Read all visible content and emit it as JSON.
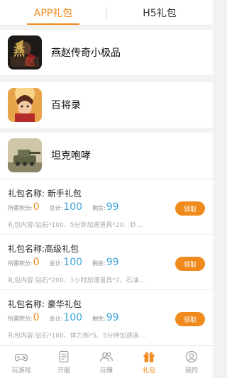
{
  "tabs": [
    {
      "label": "APP礼包",
      "active": true
    },
    {
      "label": "H5礼包",
      "active": false
    }
  ],
  "games": [
    {
      "name": "燕赵传奇小极品",
      "icon": "yanzhao-game-icon"
    },
    {
      "name": "百将录",
      "icon": "baijianglu-game-icon"
    },
    {
      "name": "坦克咆哮",
      "icon": "tank-game-icon"
    }
  ],
  "gifts": [
    {
      "title": "礼包名称: 新手礼包",
      "points_label": "所需积分:",
      "points": "0",
      "total_label": "总计:",
      "total": "100",
      "remain_label": "剩余:",
      "remain": "99",
      "content": "礼包内容:钻石*100、5分钟加速道具*20、钞…",
      "button": "领取"
    },
    {
      "title": "礼包名称:高级礼包",
      "points_label": "所需积分:",
      "points": "0",
      "total_label": "总计:",
      "total": "100",
      "remain_label": "剩余:",
      "remain": "99",
      "content": "礼包内容:钻石*200、1小时加速道具*2、石油…",
      "button": "领取"
    },
    {
      "title": "礼包名称: 豪华礼包",
      "points_label": "所需积分:",
      "points": "0",
      "total_label": "总计:",
      "total": "100",
      "remain_label": "剩余:",
      "remain": "99",
      "content": "礼包内容:钻石*100、体力瓶*5、5分钟加速道…",
      "button": "领取"
    }
  ],
  "nav": [
    {
      "label": "玩游戏",
      "icon": "gamepad-icon",
      "active": false
    },
    {
      "label": "开服",
      "icon": "server-list-icon",
      "active": false
    },
    {
      "label": "玩赚",
      "icon": "users-icon",
      "active": false
    },
    {
      "label": "礼包",
      "icon": "gift-icon",
      "active": true
    },
    {
      "label": "我的",
      "icon": "user-icon",
      "active": false
    }
  ],
  "colors": {
    "accent": "#f08a1c",
    "blue": "#3aa3d8"
  }
}
